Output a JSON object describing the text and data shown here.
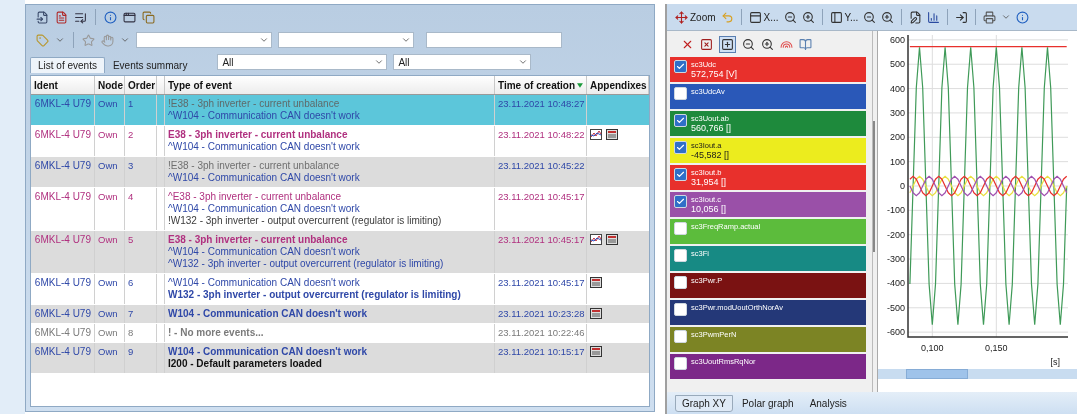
{
  "events_panel": {
    "tabs": [
      {
        "label": "List of events",
        "selected": true
      },
      {
        "label": "Events summary",
        "selected": false
      }
    ],
    "filters": [
      "All",
      "All"
    ],
    "columns": [
      {
        "label": "Ident",
        "sorted": false
      },
      {
        "label": "Node",
        "sorted": false
      },
      {
        "label": "Order",
        "sorted": false
      },
      {
        "label": "Type of event",
        "sorted": false
      },
      {
        "label": "Time of creation",
        "sorted": true
      },
      {
        "label": "Appendixes",
        "sorted": false
      }
    ],
    "rows": [
      {
        "ident": "6MKL-4 U79",
        "node": "Own",
        "order": "1",
        "color": "#2f48a8",
        "selected": true,
        "time": "23.11.2021 10:48:27",
        "appendixes": [],
        "lines": [
          {
            "text": "!E38 - 3ph inverter - current unbalance",
            "color": "#5f6a6a",
            "bold": false
          },
          {
            "text": "^W104 - Communication CAN doesn't work",
            "color": "#2f48a8",
            "bold": false
          }
        ]
      },
      {
        "ident": "6MKL-4 U79",
        "node": "Own",
        "order": "2",
        "color": "#b0307f",
        "selected": false,
        "time": "23.11.2021 10:48:22",
        "appendixes": [
          {
            "kind": "chart"
          },
          {
            "kind": "table"
          }
        ],
        "lines": [
          {
            "text": "E38 - 3ph inverter - current unbalance",
            "color": "#b0307f",
            "bold": true
          },
          {
            "text": "^W104 - Communication CAN doesn't work",
            "color": "#2f48a8",
            "bold": false
          }
        ]
      },
      {
        "ident": "6MKL-4 U79",
        "node": "Own",
        "order": "3",
        "color": "#2f48a8",
        "selected": false,
        "time": "23.11.2021 10:45:22",
        "appendixes": [],
        "lines": [
          {
            "text": "!E38 - 3ph inverter - current unbalance",
            "color": "#6f6f6f",
            "bold": false
          },
          {
            "text": "^W104 - Communication CAN doesn't work",
            "color": "#2f48a8",
            "bold": false
          }
        ]
      },
      {
        "ident": "6MKL-4 U79",
        "node": "Own",
        "order": "4",
        "color": "#b0307f",
        "selected": false,
        "time": "23.11.2021 10:45:17",
        "appendixes": [],
        "lines": [
          {
            "text": "^E38 - 3ph inverter - current unbalance",
            "color": "#b0307f",
            "bold": false
          },
          {
            "text": "^W104 - Communication CAN doesn't work",
            "color": "#2f48a8",
            "bold": false
          },
          {
            "text": "!W132 - 3ph inverter - output overcurrent (regulator is limiting)",
            "color": "#3c3c3c",
            "bold": false
          }
        ]
      },
      {
        "ident": "6MKL-4 U79",
        "node": "Own",
        "order": "5",
        "color": "#b0307f",
        "selected": false,
        "time": "23.11.2021 10:45:17",
        "appendixes": [
          {
            "kind": "chart"
          },
          {
            "kind": "table"
          }
        ],
        "lines": [
          {
            "text": "E38 - 3ph inverter - current unbalance",
            "color": "#b0307f",
            "bold": true
          },
          {
            "text": "^W104 - Communication CAN doesn't work",
            "color": "#2f48a8",
            "bold": false
          },
          {
            "text": "^W132 - 3ph inverter - output overcurrent (regulator is limiting)",
            "color": "#2f48a8",
            "bold": false
          }
        ]
      },
      {
        "ident": "6MKL-4 U79",
        "node": "Own",
        "order": "6",
        "color": "#2f48a8",
        "selected": false,
        "time": "23.11.2021 10:45:17",
        "appendixes": [
          {
            "kind": "table"
          }
        ],
        "lines": [
          {
            "text": "^W104 - Communication CAN doesn't work",
            "color": "#2f48a8",
            "bold": false
          },
          {
            "text": "W132 - 3ph inverter - output overcurrent (regulator is limiting)",
            "color": "#2f48a8",
            "bold": true
          }
        ]
      },
      {
        "ident": "6MKL-4 U79",
        "node": "Own",
        "order": "7",
        "color": "#2f48a8",
        "selected": false,
        "time": "23.11.2021 10:23:28",
        "appendixes": [
          {
            "kind": "table"
          }
        ],
        "lines": [
          {
            "text": "W104 - Communication CAN doesn't work",
            "color": "#2f48a8",
            "bold": true
          }
        ]
      },
      {
        "ident": "6MKL-4 U79",
        "node": "Own",
        "order": "8",
        "color": "#7a7a7a",
        "selected": false,
        "time": "23.11.2021 10:22:46",
        "appendixes": [],
        "lines": [
          {
            "text": "! - No more events...",
            "color": "#7a7a7a",
            "bold": true
          }
        ]
      },
      {
        "ident": "6MKL-4 U79",
        "node": "Own",
        "order": "9",
        "color": "#2f48a8",
        "selected": false,
        "time": "23.11.2021 10:15:17",
        "appendixes": [
          {
            "kind": "table"
          }
        ],
        "lines": [
          {
            "text": "W104 - Communication CAN doesn't work",
            "color": "#2f48a8",
            "bold": true
          },
          {
            "text": "I200 - Default parameters loaded",
            "color": "#111111",
            "bold": true
          }
        ]
      }
    ]
  },
  "graph_panel": {
    "toolbar": {
      "zoom": "Zoom",
      "x_axis": "X...",
      "y_axis": "Y..."
    },
    "channels": [
      {
        "name": "sc3Udc",
        "value": "572,754 [V]",
        "checked": true,
        "color": "#e8302c"
      },
      {
        "name": "sc3UdcAv",
        "checked": false,
        "color": "#2a58b8"
      },
      {
        "name": "sc3Uout.ab",
        "value": "560,766 []",
        "checked": true,
        "color": "#1e8a3c"
      },
      {
        "name": "sc3Iout.a",
        "value": "-45,582 []",
        "checked": true,
        "color": "#ecec1e"
      },
      {
        "name": "sc3Iout.b",
        "value": "31,954 []",
        "checked": true,
        "color": "#e8302c"
      },
      {
        "name": "sc3Iout.c",
        "value": "10,056 []",
        "checked": true,
        "color": "#9a50a8"
      },
      {
        "name": "sc3FreqRamp.actual",
        "checked": false,
        "color": "#5cbc3c"
      },
      {
        "name": "sc3Fi",
        "checked": false,
        "color": "#178a84"
      },
      {
        "name": "sc3Pwr.P",
        "checked": false,
        "color": "#7a1212"
      },
      {
        "name": "sc3Pwr.modUoutOrthNorAv",
        "checked": false,
        "color": "#243878"
      },
      {
        "name": "sc3PwmPerN",
        "checked": false,
        "color": "#7c8424"
      },
      {
        "name": "sc3UoutRmsRqNor",
        "checked": false,
        "color": "#7c2888"
      }
    ],
    "chart_data": {
      "type": "line",
      "xlabel": "[s]",
      "grid": true,
      "xlim": [
        0.081,
        0.206
      ],
      "ylim": [
        -620,
        620
      ],
      "xticks": [
        {
          "value": 0.1,
          "label": "0,100"
        },
        {
          "value": 0.15,
          "label": "0,150"
        }
      ],
      "yticks": [
        -600,
        -500,
        -400,
        -300,
        -200,
        -100,
        0,
        100,
        200,
        300,
        400,
        500,
        600
      ],
      "x": [
        0.0825,
        0.085,
        0.0875,
        0.09,
        0.0925,
        0.095,
        0.0975,
        0.1,
        0.1025,
        0.105,
        0.1075,
        0.11,
        0.1125,
        0.115,
        0.1175,
        0.12,
        0.1225,
        0.125,
        0.1275,
        0.13,
        0.1325,
        0.135,
        0.1375,
        0.14,
        0.1425,
        0.145,
        0.1475,
        0.15,
        0.1525,
        0.155,
        0.1575,
        0.16,
        0.1625,
        0.165,
        0.1675,
        0.17,
        0.1725,
        0.175,
        0.1775,
        0.18,
        0.1825,
        0.185,
        0.1875,
        0.19,
        0.1925,
        0.195,
        0.1975,
        0.2,
        0.2025,
        0.205
      ],
      "series": [
        {
          "color": "#e8302c",
          "values": [
            572,
            572,
            572,
            572,
            572,
            572,
            572,
            572,
            572,
            572,
            572,
            572,
            572,
            572,
            572,
            572,
            572,
            572,
            572,
            572,
            572,
            572,
            572,
            572,
            572,
            572,
            572,
            572,
            572,
            572,
            572,
            572,
            572,
            572,
            572,
            572,
            572,
            572,
            572,
            572,
            572,
            572,
            572,
            572,
            572,
            572,
            572,
            572,
            572,
            572
          ]
        },
        {
          "color": "#3f9a58",
          "values": [
            -403,
            0,
            403,
            570,
            403,
            0,
            -403,
            -570,
            -403,
            0,
            403,
            570,
            403,
            0,
            -403,
            -570,
            -403,
            0,
            403,
            570,
            403,
            0,
            -403,
            -570,
            -403,
            0,
            403,
            570,
            403,
            0,
            -403,
            -570,
            -403,
            0,
            403,
            570,
            403,
            0,
            -403,
            -570,
            -403,
            0,
            403,
            570,
            403,
            0,
            -403,
            -570,
            -403,
            0
          ]
        },
        {
          "color": "#e8e040",
          "values": [
            -28,
            0,
            28,
            40,
            28,
            0,
            -28,
            -40,
            -28,
            0,
            28,
            40,
            28,
            0,
            -28,
            -40,
            -28,
            0,
            28,
            40,
            28,
            0,
            -28,
            -40,
            -28,
            0,
            28,
            40,
            28,
            0,
            -28,
            -40,
            -28,
            0,
            28,
            40,
            28,
            0,
            -28,
            -40,
            -28,
            0,
            28,
            40,
            28,
            0,
            -28,
            -40,
            -28,
            0
          ]
        },
        {
          "color": "#e8302c",
          "values": [
            28,
            40,
            28,
            0,
            -28,
            -40,
            -28,
            0,
            28,
            40,
            28,
            0,
            -28,
            -40,
            -28,
            0,
            28,
            40,
            28,
            0,
            -28,
            -40,
            -28,
            0,
            28,
            40,
            28,
            0,
            -28,
            -40,
            -28,
            0,
            28,
            40,
            28,
            0,
            -28,
            -40,
            -28,
            0,
            28,
            40,
            28,
            0,
            -28,
            -40,
            -28,
            0,
            28,
            40
          ]
        },
        {
          "color": "#a050b0",
          "values": [
            0,
            -28,
            -40,
            -28,
            0,
            28,
            40,
            28,
            0,
            -28,
            -40,
            -28,
            0,
            28,
            40,
            28,
            0,
            -28,
            -40,
            -28,
            0,
            28,
            40,
            28,
            0,
            -28,
            -40,
            -28,
            0,
            28,
            40,
            28,
            0,
            -28,
            -40,
            -28,
            0,
            28,
            40,
            28,
            0,
            -28,
            -40,
            -28,
            0,
            28,
            40,
            28,
            0,
            -28
          ]
        }
      ]
    },
    "tabs": [
      {
        "label": "Graph XY",
        "selected": true
      },
      {
        "label": "Polar graph",
        "selected": false
      },
      {
        "label": "Analysis",
        "selected": false
      }
    ]
  }
}
